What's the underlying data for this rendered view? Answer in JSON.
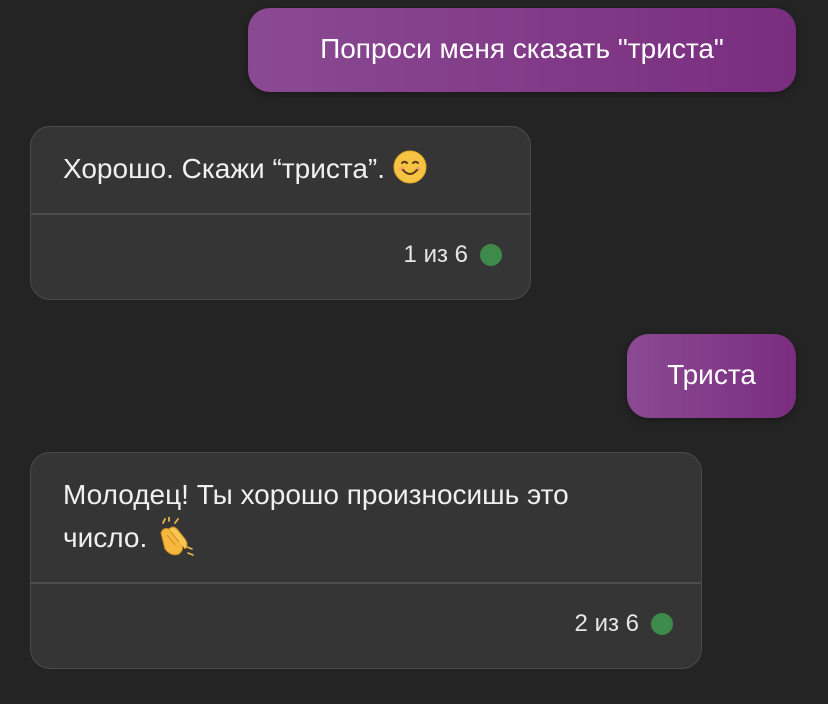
{
  "messages": [
    {
      "role": "user",
      "text": "Попроси меня сказать \"триста\""
    },
    {
      "role": "assistant",
      "text": "Хорошо. Скажи “триста”. ",
      "emoji": "smiling-face-icon",
      "counter": "1 из 6",
      "status_color": "#3e8a4a"
    },
    {
      "role": "user",
      "text": "Триста"
    },
    {
      "role": "assistant",
      "text_line1": "Молодец! Ты хорошо произносишь это",
      "text_line2": "число. ",
      "emoji": "clapping-hands-icon",
      "counter": "2 из 6",
      "status_color": "#3e8a4a"
    }
  ],
  "colors": {
    "background": "#242424",
    "user_bubble_start": "#8a4a92",
    "user_bubble_end": "#7a2d7f",
    "assistant_card": "#353535",
    "status_dot": "#3e8a4a"
  }
}
